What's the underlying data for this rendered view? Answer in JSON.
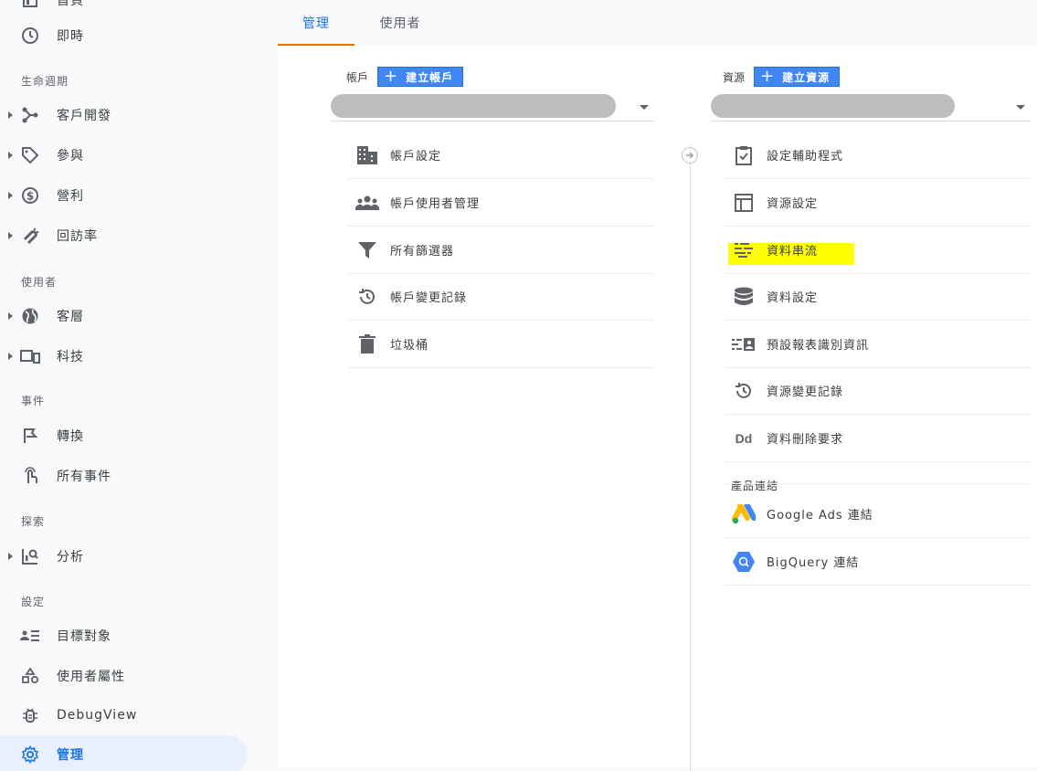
{
  "sidebar": {
    "top_partial_label": "首頁",
    "items_top": [
      {
        "label": "即時",
        "icon": "clock-icon"
      }
    ],
    "sections": [
      {
        "title": "生命週期",
        "items": [
          {
            "label": "客戶開發",
            "icon": "acquisition-icon"
          },
          {
            "label": "參與",
            "icon": "tag-icon"
          },
          {
            "label": "營利",
            "icon": "dollar-icon"
          },
          {
            "label": "回訪率",
            "icon": "magnet-icon"
          }
        ]
      },
      {
        "title": "使用者",
        "items": [
          {
            "label": "客層",
            "icon": "globe-icon"
          },
          {
            "label": "科技",
            "icon": "devices-icon"
          }
        ]
      },
      {
        "title": "事件",
        "items": [
          {
            "label": "轉換",
            "icon": "flag-icon"
          },
          {
            "label": "所有事件",
            "icon": "touch-icon"
          }
        ]
      },
      {
        "title": "探索",
        "items": [
          {
            "label": "分析",
            "icon": "analysis-icon"
          }
        ]
      },
      {
        "title": "設定",
        "items": [
          {
            "label": "目標對象",
            "icon": "audience-icon"
          },
          {
            "label": "使用者屬性",
            "icon": "shapes-icon"
          },
          {
            "label": "DebugView",
            "icon": "bug-icon"
          },
          {
            "label": "管理",
            "icon": "gear-icon"
          }
        ]
      }
    ]
  },
  "tabs": [
    {
      "label": "管理",
      "active": true
    },
    {
      "label": "使用者",
      "active": false
    }
  ],
  "account": {
    "heading": "帳戶",
    "create_label": "建立帳戶",
    "rows": [
      {
        "label": "帳戶設定",
        "icon": "building-icon"
      },
      {
        "label": "帳戶使用者管理",
        "icon": "people-icon"
      },
      {
        "label": "所有篩選器",
        "icon": "filter-icon"
      },
      {
        "label": "帳戶變更記錄",
        "icon": "history-icon"
      },
      {
        "label": "垃圾桶",
        "icon": "trash-icon"
      }
    ]
  },
  "property": {
    "heading": "資源",
    "create_label": "建立資源",
    "rows": [
      {
        "label": "設定輔助程式",
        "icon": "clipboard-check-icon"
      },
      {
        "label": "資源設定",
        "icon": "layout-icon"
      },
      {
        "label": "資料串流",
        "icon": "streams-icon"
      },
      {
        "label": "資料設定",
        "icon": "database-icon"
      },
      {
        "label": "預設報表識別資訊",
        "icon": "id-card-icon"
      },
      {
        "label": "資源變更記錄",
        "icon": "history-icon"
      },
      {
        "label": "資料刪除要求",
        "icon": "dd-icon"
      }
    ],
    "dd_text": "Dd",
    "product_links_heading": "產品連結",
    "links": [
      {
        "label": "Google Ads 連結",
        "icon": "google-ads-icon"
      },
      {
        "label": "BigQuery 連結",
        "icon": "bigquery-icon"
      }
    ]
  },
  "colors": {
    "accent": "#1a73e8",
    "tab_underline": "#e37400",
    "button": "#4285f4",
    "highlight": "#ffff00"
  }
}
